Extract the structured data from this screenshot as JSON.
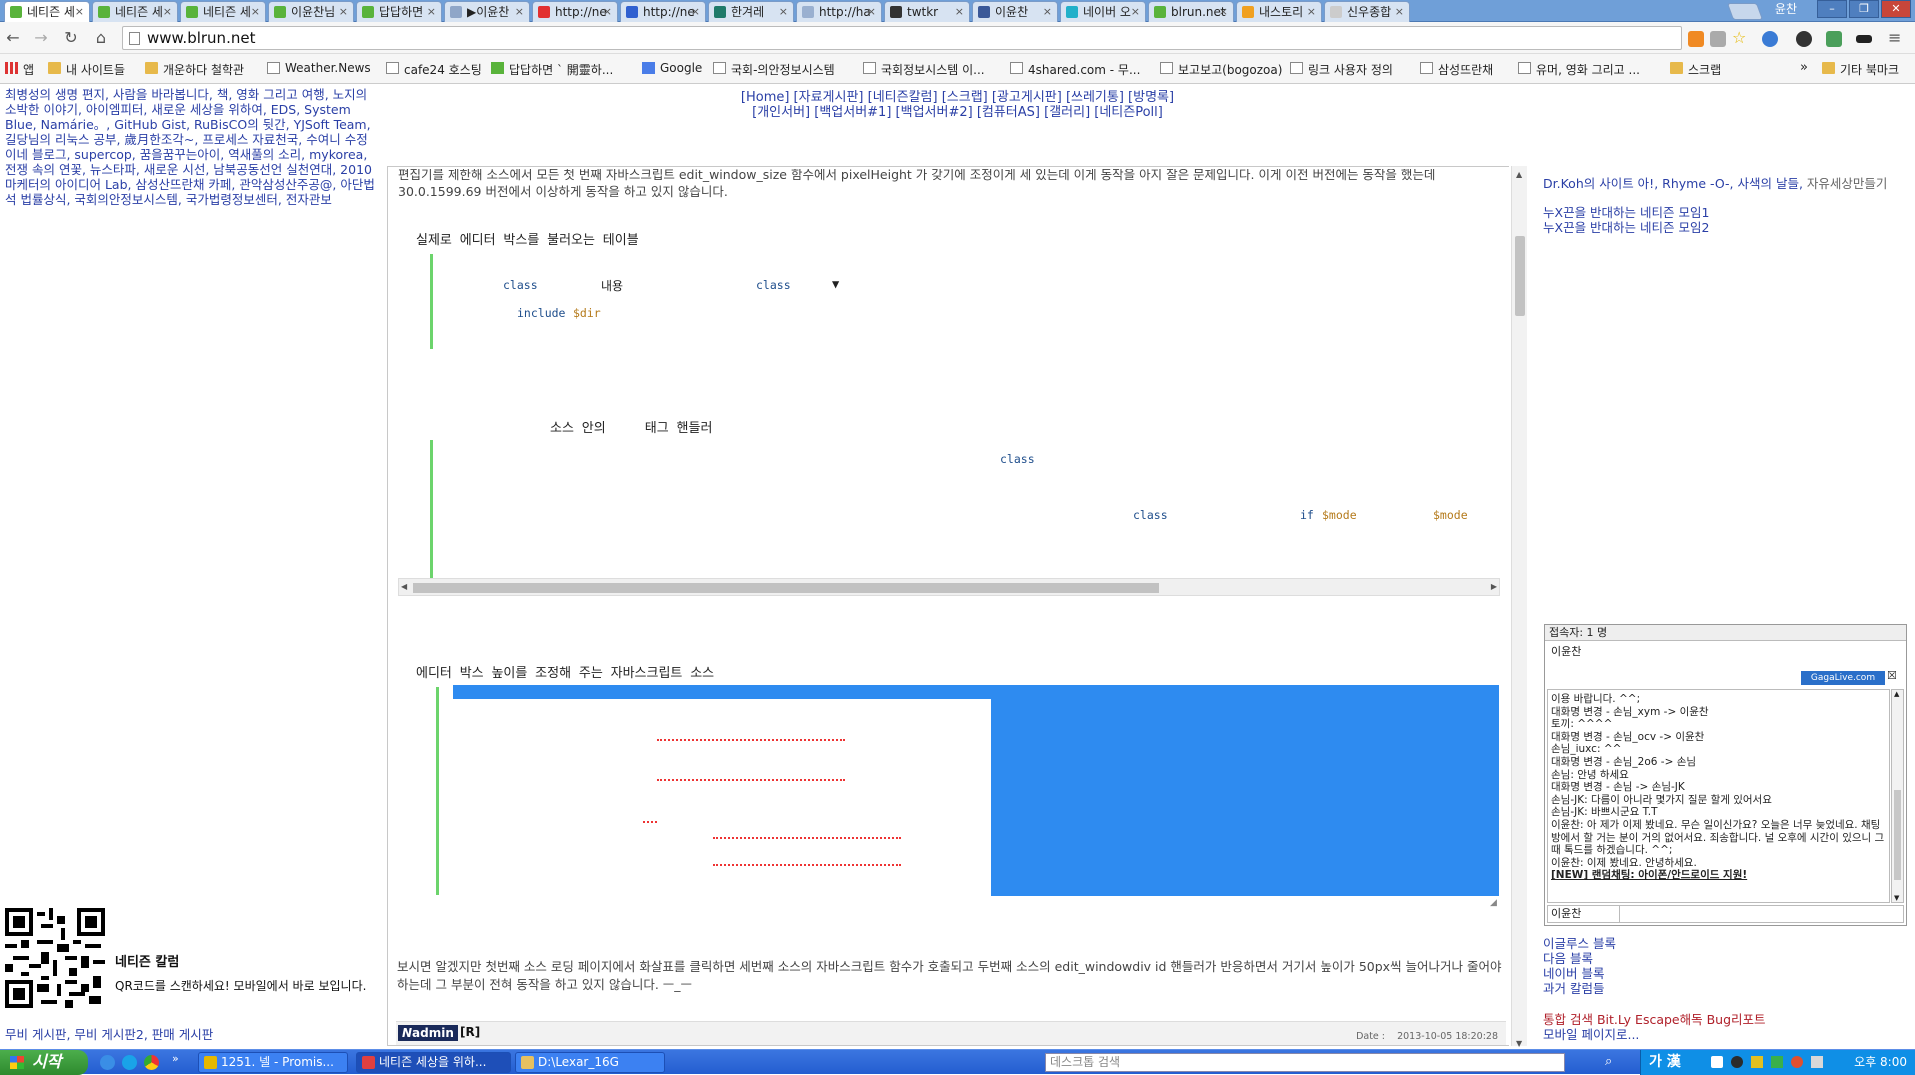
{
  "browser": {
    "tabs": [
      {
        "label": "네티즌 세",
        "icon": "#59b33b"
      },
      {
        "label": "네티즌 세",
        "icon": "#59b33b"
      },
      {
        "label": "네티즌 세",
        "icon": "#59b33b"
      },
      {
        "label": "이윤찬님",
        "icon": "#59b33b"
      },
      {
        "label": "답답하면",
        "icon": "#59b33b"
      },
      {
        "label": "▶이윤찬",
        "icon": "#8fa6c8"
      },
      {
        "label": "http://ne",
        "icon": "#e23030"
      },
      {
        "label": "http://ne",
        "icon": "#3060d0"
      },
      {
        "label": "한겨레",
        "icon": "#1f7a6a"
      },
      {
        "label": "http://ha",
        "icon": "#9ab0d0"
      },
      {
        "label": "twtkr",
        "icon": "#333333"
      },
      {
        "label": "이윤찬",
        "icon": "#3b5998"
      },
      {
        "label": "네이버 오",
        "icon": "#21b0c9"
      },
      {
        "label": "blrun.net",
        "icon": "#59b33b"
      },
      {
        "label": "내스토리",
        "icon": "#f0a020"
      },
      {
        "label": "신우종합",
        "icon": "#cccccc"
      }
    ],
    "tab_close": "×",
    "user": "윤찬",
    "address": "www.blrun.net",
    "bookmarks": [
      {
        "label": "앱"
      },
      {
        "label": "내 사이트들"
      },
      {
        "label": "개운하다 철학관"
      },
      {
        "label": "Weather.News"
      },
      {
        "label": "cafe24 호스팅"
      },
      {
        "label": "답답하면 ` 開靈하..."
      },
      {
        "label": "Google"
      },
      {
        "label": "국회-의안정보시스템"
      },
      {
        "label": "국회정보시스템 이..."
      },
      {
        "label": "4shared.com - 무..."
      },
      {
        "label": "보고보고(bogozoa)"
      },
      {
        "label": "링크 사용자 정의"
      },
      {
        "label": "삼성뜨란채"
      },
      {
        "label": "유머, 영화 그리고 ..."
      },
      {
        "label": "스크랩"
      },
      {
        "label": "기타 북마크"
      }
    ],
    "more": "»"
  },
  "site": {
    "nav_line1": "[Home] [자료게시판] [네티즌칼럼] [스크랩] [광고게시판] [쓰레기통] [방명록]",
    "nav_line2": "[개인서버] [백업서버#1] [백업서버#2] [컴퓨터AS] [갤러리] [네티즌Poll]",
    "left_links": "최병성의 생명 편지, 사람을 바라봅니다, 책, 영화 그리고 여행, 노지의 소박한 이야기, 아이엠피터, 새로운 세상을 위하여, EDS, System Blue, Namárie。, GitHub Gist, RuBisCO의 뒷간, YJSoft Team, 길당님의 리눅스 공부, 歲月한조각~, 프로세스 자료천국, 수여니 수정이네 블로그, supercop, 꿈을꿈꾸는아이, 역새풀의 소리, mykorea, 전쟁 속의 연꽃, 뉴스타파, 새로운 시선, 남북공동선언 실천연대, 2010 마케터의 아이디어 Lab, 삼성산뜨란채 카페, 관악삼성산주공@, 아단법석 법률상식, 국회의안정보시스템, 국가법령정보센터, 전자관보",
    "qr_title": "네티즌 칼럼",
    "qr_desc": "QR코드를 스캔하세요! 모바일에서 바로 보입니다.",
    "board_links": "무비 게시판, 무비 게시판2, 판매 게시판"
  },
  "post": {
    "intro": "편집기를 제한해 소스에서 모든 첫 번째 자바스크립트 edit_window_size 함수에서 pixelHeight 가 갖기에 조정이게 세 있는데 이게 동작을 아지 잘은 문제입니다. 이게 이전 버전에는 동작을 했는데 30.0.1599.69 버전에서 이상하게 동작을 하고 있지 않습니다.",
    "section1_title": "실제로 에디터 박스를 불러오는 테이블",
    "code1_class1": "class",
    "code1_content": "내용",
    "code1_class2": "class",
    "code1_arrow": "▼",
    "code1_include": "include",
    "code1_dir": "$dir",
    "section2_title": "소스 안의     태그 핸들러",
    "code2_class1": "class",
    "code2_class2": "class",
    "code2_if": "if",
    "code2_mode1": "$mode",
    "code2_mode2": "$mode",
    "section3_title": "에디터 박스 높이를 조정해 주는 자바스크립트 소스",
    "outro": "보시면 알겠지만 첫번째 소스 로딩 페이지에서 화살표를 클릭하면 세번째 소스의 자바스크립트 함수가 호출되고 두번째 소스의 edit_windowdiv id 핸들러가 반응하면서 거기서 높이가 50px씩 늘어나거나 줄어야 하는데 그 부분이 전혀 동작을 하고 있지 않습니다. ㅡ_ㅡ",
    "admin": "admin",
    "reply": "[R]",
    "date_label": "Date :",
    "date": "2013-10-05 18:20:28"
  },
  "right": {
    "top_links": "Dr.Koh의 사이트 아!, Rhyme -O-, 사색의 날들,",
    "top_links_extra": "자유세상만들기",
    "link1": "누X끈을 반대하는 네티즌 모임1",
    "link2": "누X끈을 반대하는 네티즌 모임2",
    "chat_count": "접속자: 1 명",
    "chat_user": "이윤찬",
    "gagalive": "GagaLive.com",
    "chat_close": "☒",
    "chat_lines": [
      "이용 바랍니다. ^^;",
      "대화명 변경 - 손님_xym -> 이윤찬",
      "토끼: ^^^^",
      "대화명 변경 - 손님_ocv -> 이윤찬",
      "손님_iuxc: ^^",
      "대화명 변경 - 손님_2o6 -> 손님",
      "손님: 안녕 하세요",
      "대화명 변경 - 손님 -> 손님-JK",
      "손님-JK: 다름이 아니라 몇가지 질문 할게 있어서요",
      "손님-JK: 바쁘시군요 T.T",
      "이윤찬: 아 제가 이제 봤네요. 무슨 일이신가요? 오늘은 너무 늦었네요. 채팅방에서 할 거는 분이 거의 없어서요. 죄송합니다. 널 오후에 시간이 있으니 그때 톡드를 하겠습니다. ^^;",
      "이윤찬: 이제 봤네요. 안녕하세요.",
      "[NEW] 랜덤채팅: 아이폰/안드로이드 지원!"
    ],
    "chat_nick": "이윤찬",
    "blog_links": [
      "이글루스 블록",
      "다음 블록",
      "네이버 블록",
      "과거 칼럼들"
    ],
    "bottom1": "통합 검색 Bit.Ly Escape해독 Bug리포트",
    "bottom2": "모바일 페이지로..."
  },
  "taskbar": {
    "start": "시작",
    "tasks": [
      {
        "label": "1251. 넬 - Promis..."
      },
      {
        "label": "네티즌 세상을 위하..."
      },
      {
        "label": "D:\\Lexar_16G"
      }
    ],
    "search_placeholder": "데스크톱 검색",
    "ime": "가 漢",
    "clock": "오후 8:00"
  }
}
